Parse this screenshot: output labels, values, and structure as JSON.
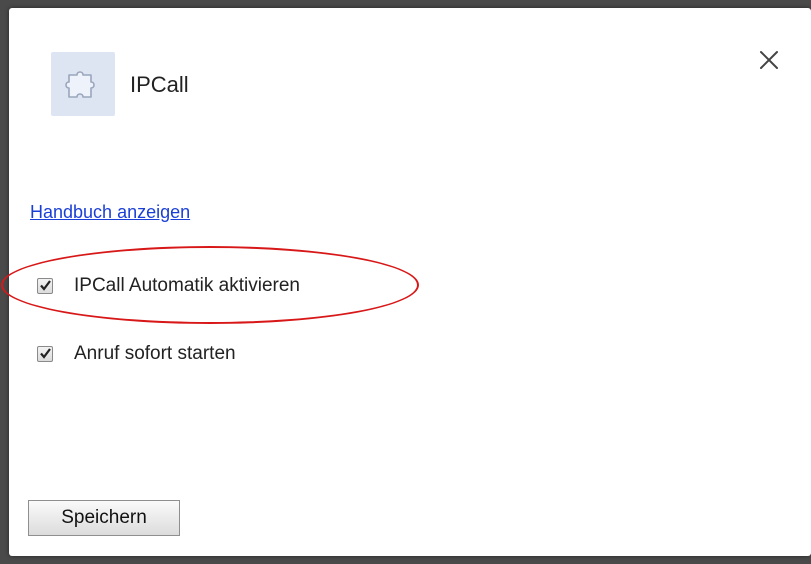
{
  "dialog": {
    "title": "IPCall",
    "icons": {
      "extension": "puzzle-piece-icon",
      "close": "close-icon"
    }
  },
  "links": {
    "manual": "Handbuch anzeigen"
  },
  "options": [
    {
      "label": "IPCall Automatik aktivieren",
      "checked": true,
      "highlighted": true
    },
    {
      "label": "Anruf sofort starten",
      "checked": true,
      "highlighted": false
    }
  ],
  "buttons": {
    "save": "Speichern"
  },
  "colors": {
    "link": "#1a3fd6",
    "highlight_ellipse": "#d81818",
    "icon_bg": "#dde5f3"
  }
}
